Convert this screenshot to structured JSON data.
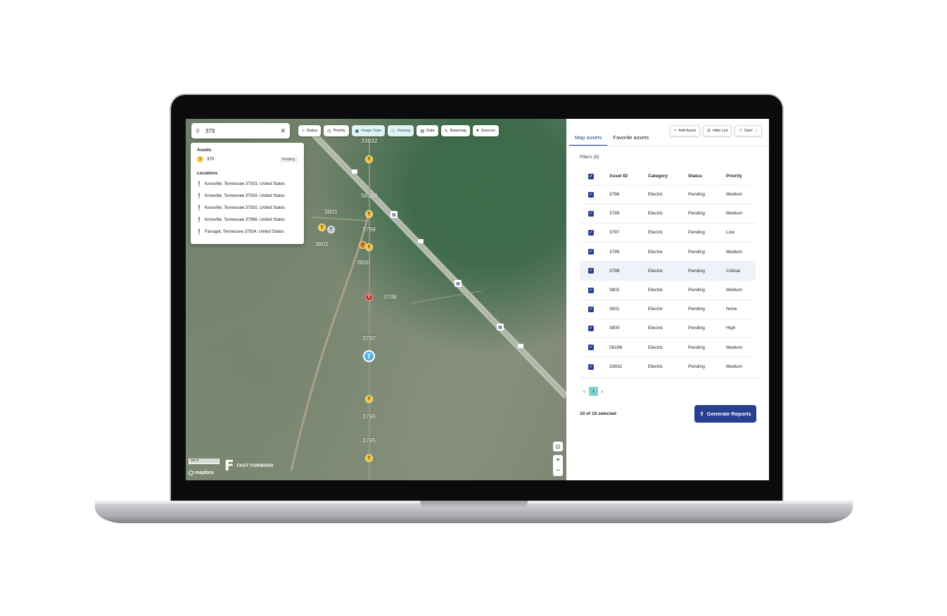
{
  "search": {
    "value": "379"
  },
  "filters": [
    {
      "label": "Status",
      "icon": "building-icon",
      "active": false
    },
    {
      "label": "Priority",
      "icon": "clock-icon",
      "active": false
    },
    {
      "label": "Image Type",
      "icon": "image-icon",
      "active": true
    },
    {
      "label": "Viewing",
      "icon": "people-icon",
      "active": true
    },
    {
      "label": "Date",
      "icon": "calendar-icon",
      "active": false
    },
    {
      "label": "Basemap",
      "icon": "pencil-icon",
      "active": false
    },
    {
      "label": "Sources",
      "icon": "drop-icon",
      "active": false
    }
  ],
  "dropdown": {
    "assets_heading": "Assets",
    "asset": {
      "id": "379",
      "badge": "Pending"
    },
    "locations_heading": "Locations",
    "locations": [
      "Knoxville, Tennessee 37919, United States",
      "Knoxville, Tennessee 37916, United States",
      "Knoxville, Tennessee 37920, United States",
      "Knoxville, Tennessee 37996, United States",
      "Farragut, Tennessee 37934, United States"
    ]
  },
  "map_labels": {
    "m33932": "33932",
    "m56198": "56198",
    "m3801": "3801",
    "m3799": "3799",
    "m3802": "3802",
    "m3800": "3800",
    "m3798": "3798",
    "m3797": "3797",
    "m3796": "3796",
    "m3795": "3795"
  },
  "map": {
    "scale": "300 ft",
    "attribution": "mapbox",
    "brand": "FAST FORWARD",
    "zoom_in": "+",
    "zoom_out": "−"
  },
  "panel": {
    "tabs": [
      "Map assets",
      "Favorite assets"
    ],
    "actions": {
      "add": "Add Asset",
      "hide": "Hide List",
      "user": "Dani"
    },
    "filters_label": "Filters (9)",
    "columns": [
      "Asset ID",
      "Category",
      "Status",
      "Priority"
    ],
    "rows": [
      {
        "id": "3796",
        "category": "Electric",
        "status": "Pending",
        "priority": "Medium"
      },
      {
        "id": "3799",
        "category": "Electric",
        "status": "Pending",
        "priority": "Medium"
      },
      {
        "id": "3797",
        "category": "Electric",
        "status": "Pending",
        "priority": "Low"
      },
      {
        "id": "3795",
        "category": "Electric",
        "status": "Pending",
        "priority": "Medium"
      },
      {
        "id": "3798",
        "category": "Electric",
        "status": "Pending",
        "priority": "Critical"
      },
      {
        "id": "3802",
        "category": "Electric",
        "status": "Pending",
        "priority": "Medium"
      },
      {
        "id": "3801",
        "category": "Electric",
        "status": "Pending",
        "priority": "None"
      },
      {
        "id": "3800",
        "category": "Electric",
        "status": "Pending",
        "priority": "High"
      },
      {
        "id": "56198",
        "category": "Electric",
        "status": "Pending",
        "priority": "Medium"
      },
      {
        "id": "33932",
        "category": "Electric",
        "status": "Pending",
        "priority": "Medium"
      }
    ],
    "page": "1",
    "selected_text": "10 of 10 selected",
    "generate_label": "Generate Reports"
  },
  "colors": {
    "accent": "#283f8f",
    "page_chip": "#7fd3d0",
    "marker_yellow": "#f1c232",
    "marker_red": "#c8302c",
    "marker_blue": "#4fb3e8"
  }
}
